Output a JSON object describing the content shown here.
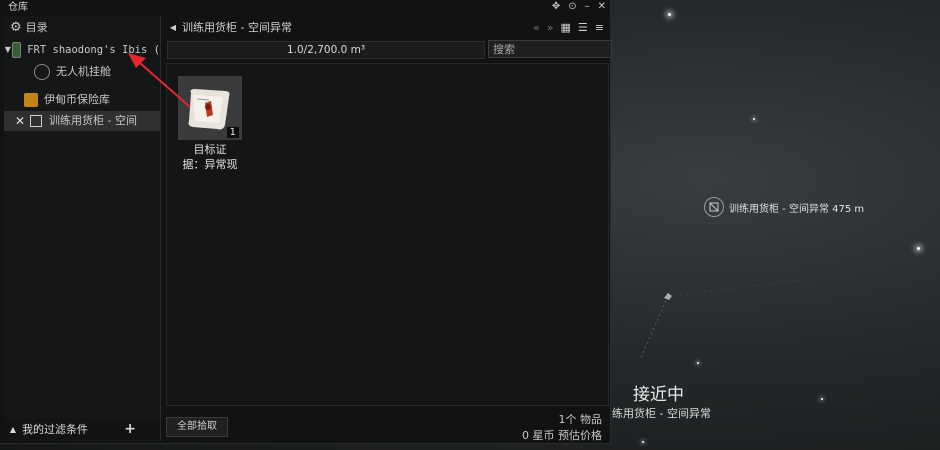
{
  "window": {
    "title": "仓库"
  },
  "left_panel": {
    "directory_label": "目录",
    "tree": [
      {
        "label": "FRT shaodong's Ibis (",
        "kind": "ship"
      },
      {
        "label": "无人机挂舱",
        "kind": "drone-bay"
      },
      {
        "label": "伊甸币保险库",
        "kind": "vault"
      },
      {
        "label": "训练用货柜 - 空间",
        "kind": "container",
        "selected": true
      }
    ],
    "filter_label": "我的过滤条件"
  },
  "container": {
    "title": "训练用货柜 - 空间异常",
    "capacity": "1.0/2,700.0 m³",
    "search_placeholder": "搜索",
    "items": [
      {
        "name_line1": "目标证",
        "name_line2": "据：异常现",
        "quantity": "1",
        "icon": "scroll-certificate-icon"
      }
    ],
    "pick_all_label": "全部拾取",
    "count_value": "1个",
    "count_label": "物品",
    "price_value": "0 星币",
    "price_label": "预估价格"
  },
  "space": {
    "bracket_label": "训练用货柜 - 空间异常 475 m",
    "approach_label": "接近中",
    "approach_target": "练用货柜 - 空间异常"
  },
  "colors": {
    "annotation_arrow": "#e0282e",
    "accent": "#e6a020"
  }
}
